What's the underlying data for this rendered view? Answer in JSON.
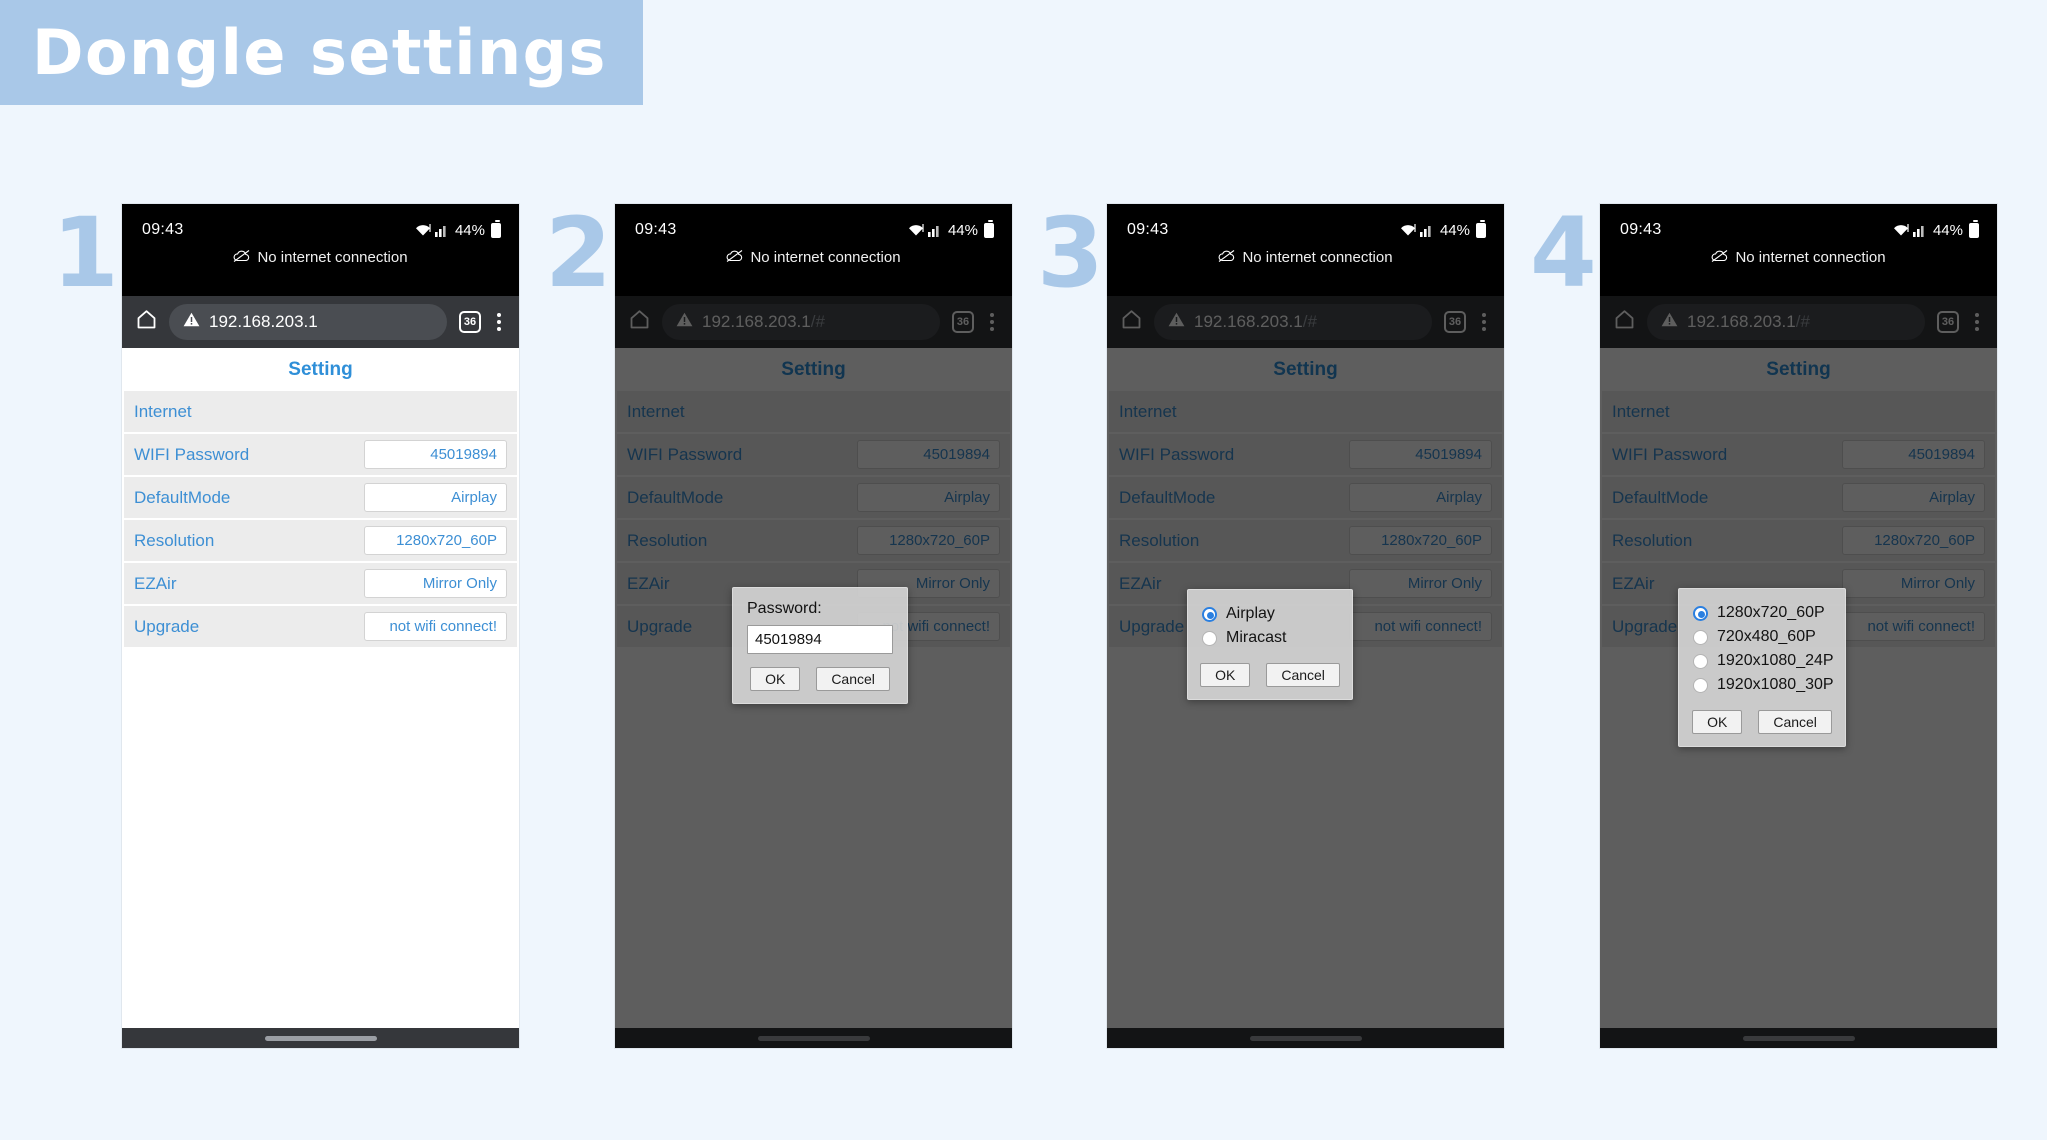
{
  "banner": {
    "title": "Dongle settings",
    "bg_color": "#a9c8e8",
    "text_color": "#ffffff"
  },
  "page": {
    "background": "#eff6fd",
    "accent": "#3d8fd4"
  },
  "steps": [
    {
      "number": "1"
    },
    {
      "number": "2"
    },
    {
      "number": "3"
    },
    {
      "number": "4"
    }
  ],
  "status_bar": {
    "clock": "09:43",
    "battery_percent": "44%",
    "network_notice": "No internet connection",
    "wifi_icon": "wifi-icon",
    "signal_icon": "signal-bars-icon",
    "battery_icon": "battery-icon",
    "cloud_off_icon": "cloud-off-icon"
  },
  "browser": {
    "home_icon": "home-icon",
    "security_icon": "warning-triangle-icon",
    "url_base": "192.168.203.1",
    "url_fragment": "/#",
    "tab_count": "36",
    "menu_icon": "overflow-menu-icon"
  },
  "settings": {
    "title": "Setting",
    "rows": [
      {
        "label": "Internet",
        "value": null
      },
      {
        "label": "WIFI Password",
        "value": "45019894"
      },
      {
        "label": "DefaultMode",
        "value": "Airplay"
      },
      {
        "label": "Resolution",
        "value": "1280x720_60P"
      },
      {
        "label": "EZAir",
        "value": "Mirror Only"
      },
      {
        "label": "Upgrade",
        "value": "not wifi connect!"
      }
    ]
  },
  "dialogs": {
    "password": {
      "label": "Password:",
      "value": "45019894",
      "ok": "OK",
      "cancel": "Cancel"
    },
    "default_mode": {
      "options": [
        {
          "label": "Airplay",
          "selected": true
        },
        {
          "label": "Miracast",
          "selected": false
        }
      ],
      "ok": "OK",
      "cancel": "Cancel"
    },
    "resolution": {
      "options": [
        {
          "label": "1280x720_60P",
          "selected": true
        },
        {
          "label": "720x480_60P",
          "selected": false
        },
        {
          "label": "1920x1080_24P",
          "selected": false
        },
        {
          "label": "1920x1080_30P",
          "selected": false
        }
      ],
      "ok": "OK",
      "cancel": "Cancel"
    }
  }
}
